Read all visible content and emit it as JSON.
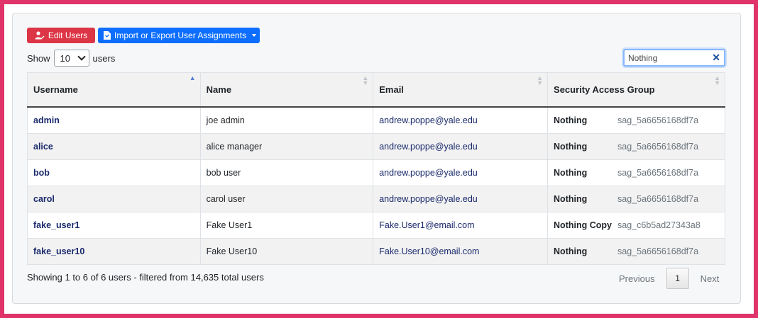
{
  "toolbar": {
    "edit_users_label": "Edit Users",
    "import_export_label": "Import or Export User Assignments"
  },
  "length": {
    "show_label": "Show",
    "selected": "10",
    "suffix": "users"
  },
  "search": {
    "value": "Nothing"
  },
  "table": {
    "columns": [
      "Username",
      "Name",
      "Email",
      "Security Access Group"
    ],
    "rows": [
      {
        "username": "admin",
        "name": "joe admin",
        "email": "andrew.poppe@yale.edu",
        "group": "Nothing",
        "group_id": "sag_5a6656168df7a"
      },
      {
        "username": "alice",
        "name": "alice manager",
        "email": "andrew.poppe@yale.edu",
        "group": "Nothing",
        "group_id": "sag_5a6656168df7a"
      },
      {
        "username": "bob",
        "name": "bob user",
        "email": "andrew.poppe@yale.edu",
        "group": "Nothing",
        "group_id": "sag_5a6656168df7a"
      },
      {
        "username": "carol",
        "name": "carol user",
        "email": "andrew.poppe@yale.edu",
        "group": "Nothing",
        "group_id": "sag_5a6656168df7a"
      },
      {
        "username": "fake_user1",
        "name": "Fake User1",
        "email": "Fake.User1@email.com",
        "group": "Nothing Copy",
        "group_id": "sag_c6b5ad27343a8"
      },
      {
        "username": "fake_user10",
        "name": "Fake User10",
        "email": "Fake.User10@email.com",
        "group": "Nothing",
        "group_id": "sag_5a6656168df7a"
      }
    ]
  },
  "footer": {
    "info": "Showing 1 to 6 of 6 users - filtered from 14,635 total users",
    "previous": "Previous",
    "page": "1",
    "next": "Next"
  },
  "colors": {
    "frame": "#e0336a",
    "danger": "#dc3545",
    "primary": "#0d6efd"
  }
}
